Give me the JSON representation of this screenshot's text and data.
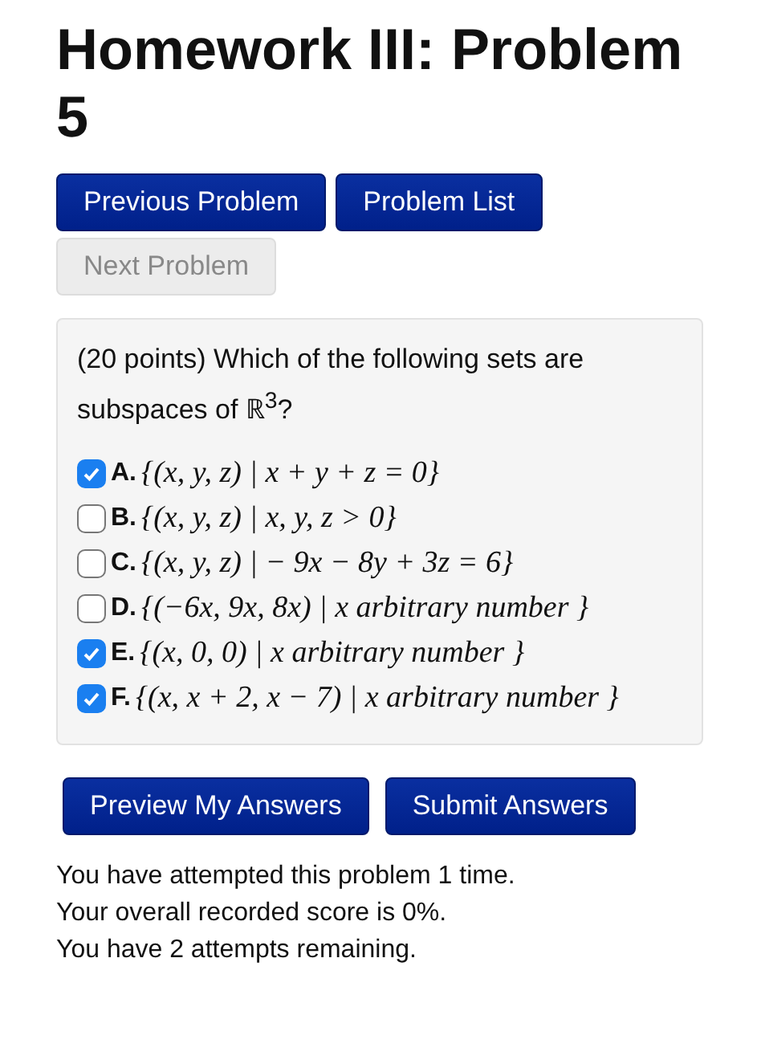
{
  "title": "Homework III: Problem 5",
  "nav_buttons": [
    {
      "label": "Previous Problem",
      "disabled": false
    },
    {
      "label": "Problem List",
      "disabled": false
    },
    {
      "label": "Next Problem",
      "disabled": true
    }
  ],
  "problem": {
    "prompt": "(20 points) Which of the following sets are subspaces of ℝ$^{3}$?",
    "options": [
      {
        "letter": "A.",
        "text": "{(x, y, z) | x + y + z = 0}",
        "checked": true
      },
      {
        "letter": "B.",
        "text": "{(x, y, z) | x, y, z > 0}",
        "checked": false
      },
      {
        "letter": "C.",
        "text": "{(x, y, z) |  − 9x − 8y + 3z = 6}",
        "checked": false
      },
      {
        "letter": "D.",
        "text": "{(−6x, 9x, 8x) | x arbitrary number }",
        "checked": false
      },
      {
        "letter": "E.",
        "text": "{(x, 0, 0) | x arbitrary number }",
        "checked": true
      },
      {
        "letter": "F.",
        "text": "{(x, x + 2, x − 7) | x arbitrary number }",
        "checked": true
      }
    ]
  },
  "submit_buttons": [
    {
      "label": "Preview My Answers"
    },
    {
      "label": "Submit Answers"
    }
  ],
  "status_lines": [
    "You have attempted this problem 1 time.",
    "Your overall recorded score is 0%.",
    "You have 2 attempts remaining."
  ]
}
